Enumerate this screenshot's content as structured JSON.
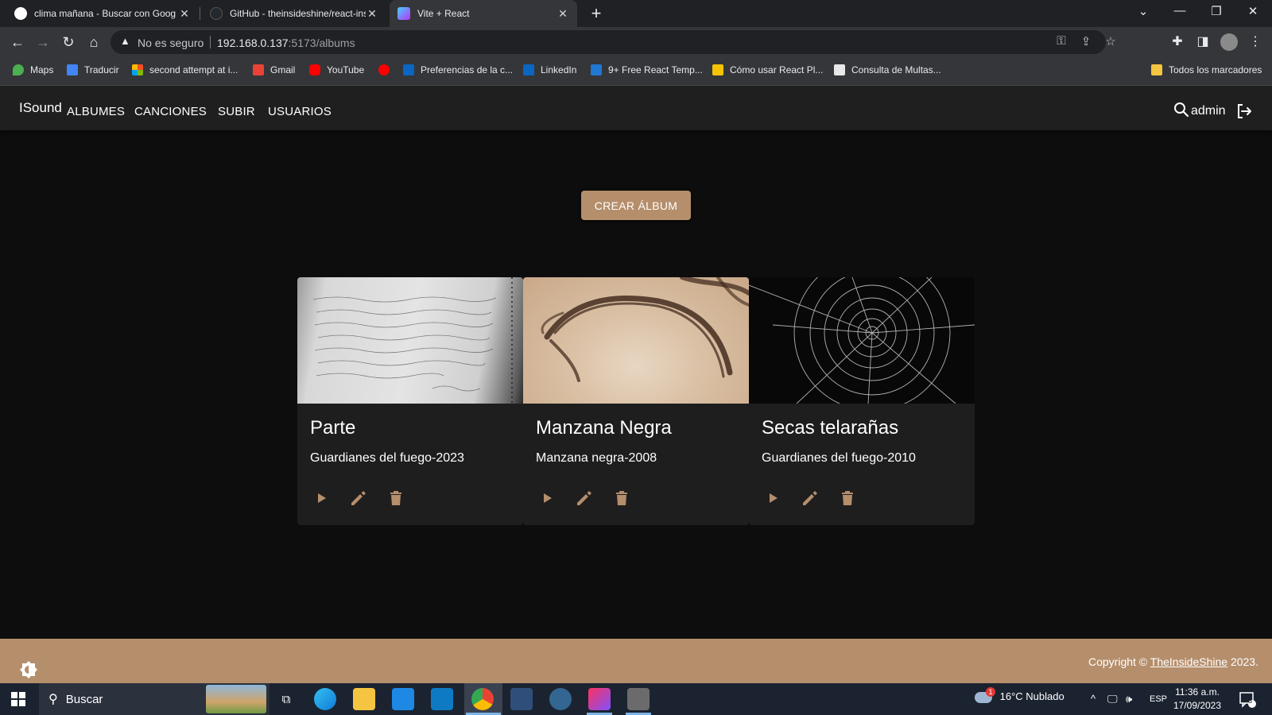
{
  "browser": {
    "tabs": [
      {
        "title": "clima mañana - Buscar con Goog",
        "active": false
      },
      {
        "title": "GitHub - theinsideshine/react-ins",
        "active": false
      },
      {
        "title": "Vite + React",
        "active": true
      }
    ],
    "security_label": "No es seguro",
    "url_host": "192.168.0.137",
    "url_rest": ":5173/albums",
    "bookmarks": [
      {
        "label": "Maps",
        "color": "#4caf50"
      },
      {
        "label": "Traducir",
        "color": "#4285f4"
      },
      {
        "label": "second attempt at i...",
        "color": "#f4b400"
      },
      {
        "label": "Gmail",
        "color": "#ea4335"
      },
      {
        "label": "YouTube",
        "color": "#ff0000"
      },
      {
        "label": "Preferencias de la c...",
        "color": "#0a66c2"
      },
      {
        "label": "LinkedIn",
        "color": "#0a66c2"
      },
      {
        "label": "9+ Free React Temp...",
        "color": "#1f78d1"
      },
      {
        "label": "Cómo usar React Pl...",
        "color": "#f5c400"
      },
      {
        "label": "Consulta de Multas...",
        "color": "#e8e8e8"
      }
    ],
    "all_bookmarks_label": "Todos los marcadores"
  },
  "app": {
    "brand": "ISound",
    "nav": {
      "albums": "ALBUMES",
      "songs": "CANCIONES",
      "upload": "SUBIR",
      "users": "USUARIOS"
    },
    "username": "admin",
    "create_button": "CREAR ÁLBUM",
    "albums": [
      {
        "title": "Parte",
        "subtitle": "Guardianes del fuego-2023"
      },
      {
        "title": "Manzana Negra",
        "subtitle": "Manzana negra-2008"
      },
      {
        "title": "Secas telarañas",
        "subtitle": "Guardianes del fuego-2010"
      }
    ],
    "accent_color": "#b58e6c",
    "footer": {
      "copyright_prefix": "Copyright © ",
      "author": "TheInsideShine",
      "year": " 2023."
    }
  },
  "taskbar": {
    "search_placeholder": "Buscar",
    "weather": "16°C  Nublado",
    "weather_badge": "1",
    "language": "ESP",
    "time": "11:36 a.m.",
    "date": "17/09/2023",
    "notifications": "3"
  }
}
